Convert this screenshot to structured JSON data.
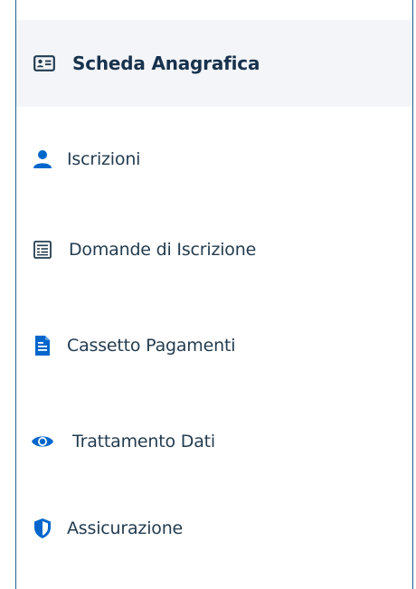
{
  "menu": {
    "items": [
      {
        "label": "Scheda Anagrafica",
        "icon": "id-card-icon",
        "active": true
      },
      {
        "label": "Iscrizioni",
        "icon": "user-icon",
        "active": false
      },
      {
        "label": "Domande di Iscrizione",
        "icon": "form-icon",
        "active": false
      },
      {
        "label": "Cassetto Pagamenti",
        "icon": "document-icon",
        "active": false
      },
      {
        "label": "Trattamento Dati",
        "icon": "eye-icon",
        "active": false
      },
      {
        "label": "Assicurazione",
        "icon": "shield-icon",
        "active": false
      }
    ]
  },
  "colors": {
    "accent": "#0066cc",
    "text": "#243c50",
    "active_background": "#f4f5f8",
    "frame_border": "#1f5d8f"
  }
}
